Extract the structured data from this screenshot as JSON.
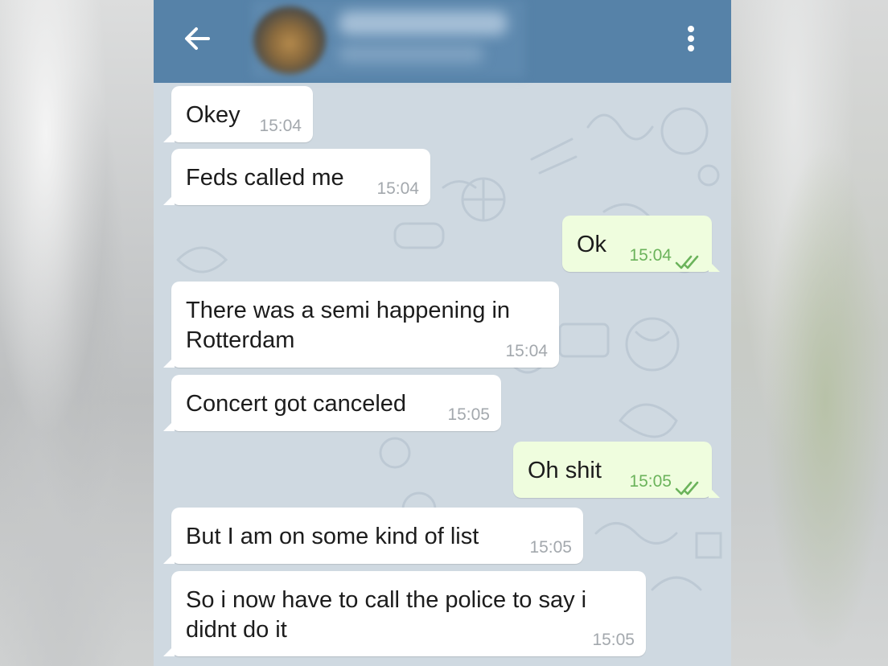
{
  "header": {
    "back_icon": "arrow-left-icon",
    "menu_icon": "vertical-dots-icon",
    "bar_color": "#5682a8"
  },
  "colors": {
    "incoming_bubble": "#ffffff",
    "outgoing_bubble": "#effdde",
    "chat_background": "#cfd9e1",
    "outgoing_time": "#6bb35b",
    "incoming_time": "#a3a8ad"
  },
  "messages": [
    {
      "direction": "incoming",
      "text": "Okey",
      "time": "15:04"
    },
    {
      "direction": "incoming",
      "text": "Feds called me",
      "time": "15:04"
    },
    {
      "direction": "outgoing",
      "text": "Ok",
      "time": "15:04",
      "status_icon": "double-check-icon"
    },
    {
      "direction": "incoming",
      "text": "There was a semi happening in\nRotterdam",
      "time": "15:04"
    },
    {
      "direction": "incoming",
      "text": "Concert got canceled",
      "time": "15:05"
    },
    {
      "direction": "outgoing",
      "text": "Oh shit",
      "time": "15:05",
      "status_icon": "double-check-icon"
    },
    {
      "direction": "incoming",
      "text": "But I am on some kind of list",
      "time": "15:05"
    },
    {
      "direction": "incoming",
      "text": "So i now have to call the police to say i\ndidnt do it",
      "time": "15:05"
    }
  ]
}
